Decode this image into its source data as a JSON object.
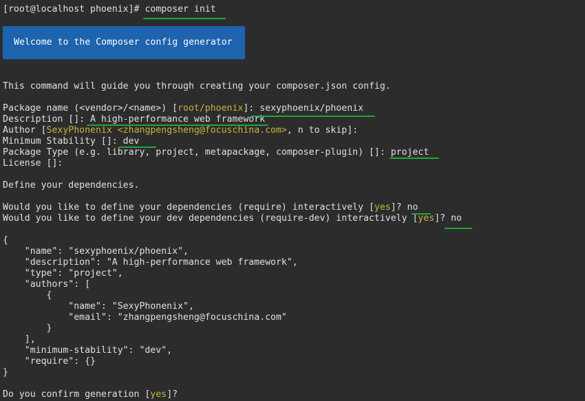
{
  "terminal": {
    "prompt": "[root@localhost phoenix]# ",
    "command": "composer init",
    "banner": "Welcome to the Composer config generator",
    "intro": "This command will guide you through creating your composer.json config.",
    "package_name": {
      "prefix": "Package name (<vendor>/<name>) [",
      "default": "root/phoenix",
      "suffix": "]: ",
      "answer": "sexyphoenix/phoenix"
    },
    "description": {
      "prefix": "Description []: ",
      "answer": "A high-performance web framework"
    },
    "author": {
      "prefix": "Author [",
      "default": "SexyPhonenix <zhangpengsheng@focuschina.com>",
      "suffix": ", n to skip]:"
    },
    "stability": {
      "prefix": "Minimum Stability []: ",
      "answer": "dev"
    },
    "package_type": {
      "prefix": "Package Type (e.g. library, project, metapackage, composer-plugin) []: ",
      "answer": "project"
    },
    "license": "License []:",
    "define_deps": "Define your dependencies.",
    "require_q": {
      "prefix": "Would you like to define your dependencies (require) interactively [",
      "default": "yes",
      "suffix": "]? ",
      "answer": "no"
    },
    "require_dev_q": {
      "prefix": "Would you like to define your dev dependencies (require-dev) interactively [",
      "default": "yes",
      "suffix": "]? ",
      "answer": "no"
    },
    "json_lines": [
      "{",
      "    \"name\": \"sexyphoenix/phoenix\",",
      "    \"description\": \"A high-performance web framework\",",
      "    \"type\": \"project\",",
      "    \"authors\": [",
      "        {",
      "            \"name\": \"SexyPhonenix\",",
      "            \"email\": \"zhangpengsheng@focuschina.com\"",
      "        }",
      "    ],",
      "    \"minimum-stability\": \"dev\",",
      "    \"require\": {}",
      "}"
    ],
    "confirm": {
      "prefix": "Do you confirm generation [",
      "default": "yes",
      "suffix": "]?"
    }
  }
}
